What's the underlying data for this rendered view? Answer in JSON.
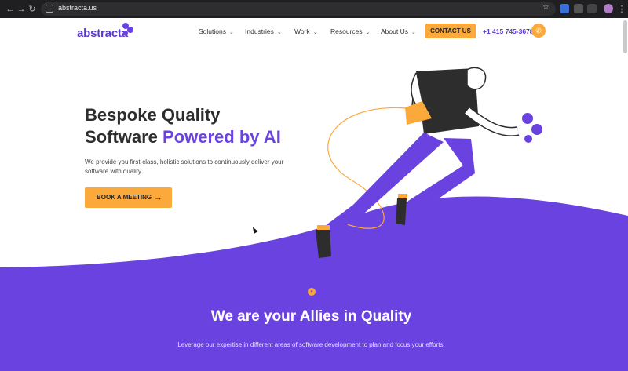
{
  "browser": {
    "url": "abstracta.us",
    "back_icon": "arrow-left",
    "forward_icon": "arrow-right",
    "reload_icon": "reload"
  },
  "header": {
    "logo_text": "abstracta",
    "nav": [
      {
        "label": "Solutions"
      },
      {
        "label": "Industries"
      },
      {
        "label": "Work"
      },
      {
        "label": "Resources"
      },
      {
        "label": "About Us"
      }
    ],
    "contact_label": "CONTACT US",
    "phone": "+1 415 745-3678"
  },
  "hero": {
    "title_line1": "Bespoke Quality",
    "title_line2_plain": "Software ",
    "title_line2_accent": "Powered by AI",
    "subtitle": "We provide you first-class, holistic solutions to continuously deliver your software with quality.",
    "cta_label": "BOOK A MEETING"
  },
  "allies": {
    "title": "We are your Allies in Quality",
    "subtitle": "Leverage our expertise in different areas of software development to plan and focus your efforts."
  },
  "colors": {
    "brand_purple": "#6a42e0",
    "accent_orange": "#fca93c",
    "chrome_dark": "#1f1f22"
  }
}
